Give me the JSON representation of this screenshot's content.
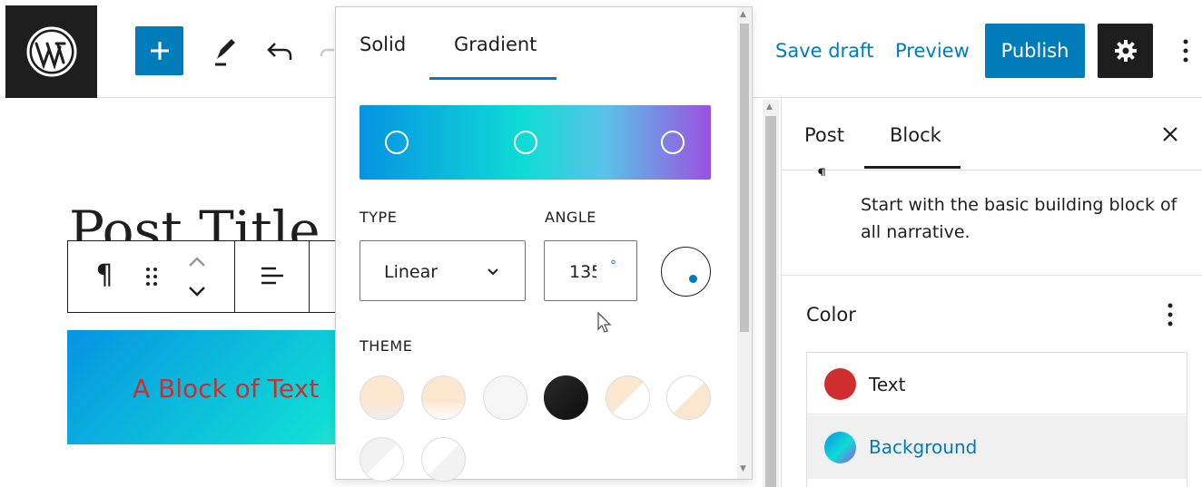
{
  "topbar": {
    "save_draft": "Save draft",
    "preview": "Preview",
    "publish": "Publish",
    "icons": [
      "wordpress-logo",
      "plus-icon",
      "pen-icon",
      "undo-icon",
      "redo-icon",
      "gear-icon",
      "more-vertical-icon"
    ]
  },
  "editor": {
    "post_title": "Post Title",
    "block_text": "A Block of Text",
    "toolbar_icons": [
      "paragraph-icon",
      "drag-handle-icon",
      "move-up-icon",
      "move-down-icon",
      "align-left-icon"
    ]
  },
  "popover": {
    "tabs": [
      "Solid",
      "Gradient"
    ],
    "active_tab": "Gradient",
    "type_label": "TYPE",
    "type_value": "Linear",
    "angle_label": "ANGLE",
    "angle_value": "135",
    "angle_unit": "°",
    "theme_label": "THEME",
    "gradient_colors": [
      "#0693e3",
      "#0fdcd5",
      "#9b51e0"
    ]
  },
  "sidebar": {
    "tabs": [
      "Post",
      "Block"
    ],
    "active_tab": "Block",
    "block_description": "Start with the basic building block of all narrative.",
    "color_section_title": "Color",
    "color_items": [
      {
        "label": "Text",
        "color": "#cf2e2e"
      },
      {
        "label": "Background",
        "color": "gradient"
      }
    ]
  },
  "colors": {
    "accent": "#007cba",
    "dark": "#1e1e1e",
    "text_red": "#cf2e2e"
  }
}
